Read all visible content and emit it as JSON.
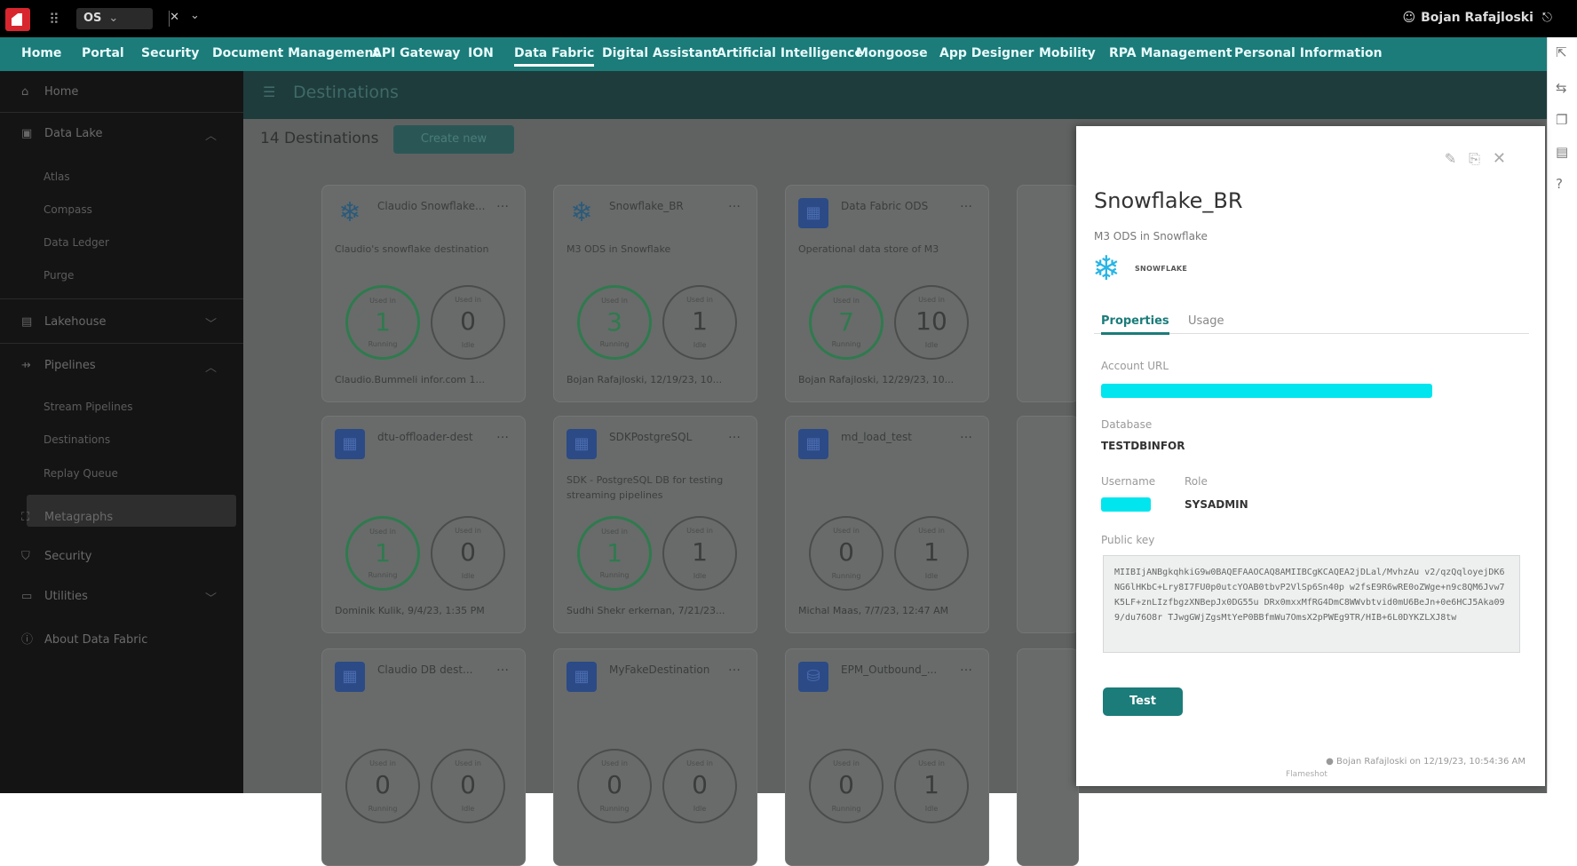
{
  "topbar": {
    "app_tab": "OS",
    "user_name": "Bojan Rafajloski"
  },
  "nav": [
    "Home",
    "Portal",
    "Security",
    "Document Management",
    "API Gateway",
    "ION",
    "Data Fabric",
    "Digital Assistant",
    "Artificial Intelligence",
    "Mongoose",
    "App Designer",
    "Mobility",
    "RPA Management",
    "Personal Information"
  ],
  "nav_active": "Data Fabric",
  "sidebar": {
    "home": "Home",
    "data_lake": "Data Lake",
    "data_lake_sub": [
      "Atlas",
      "Compass",
      "Data Ledger",
      "Purge"
    ],
    "lakehouse": "Lakehouse",
    "pipelines": "Pipelines",
    "pipelines_sub": [
      "Stream Pipelines",
      "Destinations",
      "Replay Queue"
    ],
    "metagraphs": "Metagraphs",
    "security": "Security",
    "utilities": "Utilities",
    "about": "About Data Fabric"
  },
  "main": {
    "header": "Destinations",
    "count": "14 Destinations",
    "create_btn": "Create new"
  },
  "cards": [
    {
      "title": "Claudio Snowflake...",
      "desc": "Claudio's snowflake destination",
      "a": "1",
      "b": "0",
      "foot": "Claudio.Bummeli infor.com 1..."
    },
    {
      "title": "Snowflake_BR",
      "desc": "M3 ODS in Snowflake",
      "a": "3",
      "b": "1",
      "foot": "Bojan Rafajloski, 12/19/23, 10..."
    },
    {
      "title": "Data Fabric ODS",
      "desc": "Operational data store of M3",
      "a": "7",
      "b": "10",
      "foot": "Bojan Rafajloski, 12/29/23, 10..."
    },
    {
      "title": "dtu-offloader-dest",
      "desc": "",
      "a": "1",
      "b": "0",
      "foot": "Dominik Kulik, 9/4/23, 1:35 PM"
    },
    {
      "title": "SDKPostgreSQL",
      "desc": "SDK - PostgreSQL DB for testing streaming pipelines",
      "a": "1",
      "b": "1",
      "foot": "Sudhi Shekr erkernan, 7/21/23..."
    },
    {
      "title": "md_load_test",
      "desc": "",
      "a": "0",
      "b": "1",
      "foot": "Michal Maas, 7/7/23, 12:47 AM"
    },
    {
      "title": "Claudio DB dest...",
      "desc": "",
      "a": "0",
      "b": "0",
      "foot": ""
    },
    {
      "title": "MyFakeDestination",
      "desc": "",
      "a": "0",
      "b": "0",
      "foot": ""
    },
    {
      "title": "EPM_Outbound_...",
      "desc": "",
      "a": "0",
      "b": "1",
      "foot": ""
    }
  ],
  "ring_labels": {
    "used_in": "Used in",
    "running": "Running",
    "idle": "Idle"
  },
  "panel": {
    "title": "Snowflake_BR",
    "subtitle": "M3 ODS in Snowflake",
    "logo_text": "SNOWFLAKE",
    "tabs": [
      "Properties",
      "Usage"
    ],
    "account_url_label": "Account URL",
    "database_label": "Database",
    "database_value": "TESTDBINFOR",
    "username_label": "Username",
    "role_label": "Role",
    "role_value": "SYSADMIN",
    "public_key_label": "Public key",
    "public_key": "MIIBIjANBgkqhkiG9w0BAQEFAAOCAQ8AMIIBCgKCAQEA2jDLal/MvhzAu v2/qzQqloyejDK6NG6lHKbC+Lry8I7FU0p0utcYOAB0tbvP2VlSp6Sn40p w2fsE9R6wRE0oZWge+n9c8QM6Jvw7K5LF+znLIzfbgzXNBepJx0DG55u DRx0mxxMfRG4DmC8WWvbtvid0mU6BeJn+0e6HCJ5Aka099/du76O8r TJwgGWjZgsMtYeP0BBfmWu7OmsX2pPWEg9TR/HIB+6L0DYKZLXJ8tw",
    "test_btn": "Test",
    "footer": "Bojan Rafajloski on 12/19/23, 10:54:36 AM",
    "footer2": "Flameshot"
  }
}
